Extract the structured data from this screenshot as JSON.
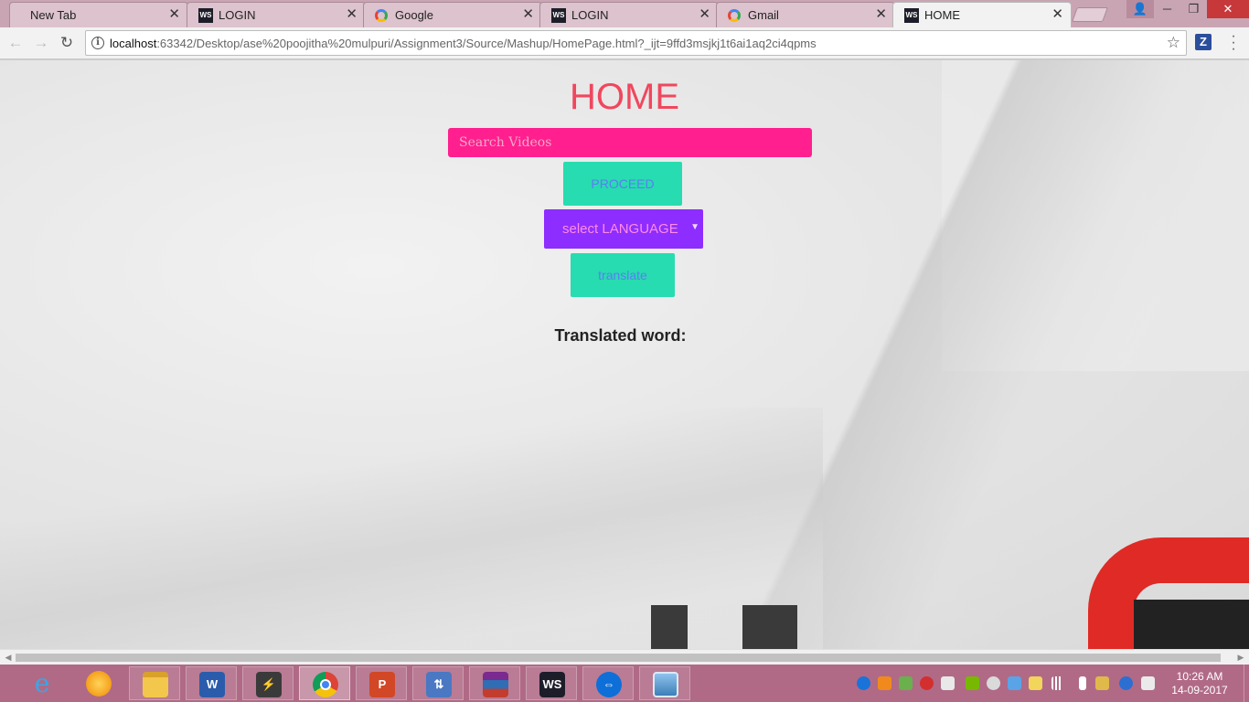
{
  "browser": {
    "tabs": [
      {
        "title": "New Tab",
        "icon": "none"
      },
      {
        "title": "LOGIN",
        "icon": "webstorm-icon"
      },
      {
        "title": "Google",
        "icon": "google-icon"
      },
      {
        "title": "LOGIN",
        "icon": "webstorm-icon"
      },
      {
        "title": "Gmail",
        "icon": "google-icon"
      },
      {
        "title": "HOME",
        "icon": "webstorm-icon",
        "active": true
      }
    ],
    "tab_close_glyph": "✕",
    "url_host": "localhost",
    "url_rest": ":63342/Desktop/ase%20poojitha%20mulpuri/Assignment3/Source/Mashup/HomePage.html?_ijt=9ffd3msjkj1t6ai1aq2ci4qpms",
    "extension_label": "Z"
  },
  "page": {
    "title": "HOME",
    "search_placeholder": "Search Videos",
    "proceed_label": "PROCEED",
    "language_select_value": "select LANGUAGE",
    "translate_label": "translate",
    "translated_label": "Translated word:",
    "colors": {
      "title": "#f0475e",
      "search_bg": "#ff1f8e",
      "button_bg": "#27dcb0",
      "button_text": "#5b7df3",
      "select_bg": "#8e2dff",
      "select_text": "#ff8be8"
    }
  },
  "taskbar": {
    "apps": [
      "internet-explorer-icon",
      "media-player-icon",
      "file-explorer-icon",
      "word-icon",
      "winamp-icon",
      "chrome-icon",
      "powerpoint-icon",
      "network-icon",
      "winrar-icon",
      "webstorm-icon",
      "teamviewer-icon",
      "photo-viewer-icon"
    ],
    "clock_time": "10:26 AM",
    "clock_date": "14-09-2017"
  }
}
